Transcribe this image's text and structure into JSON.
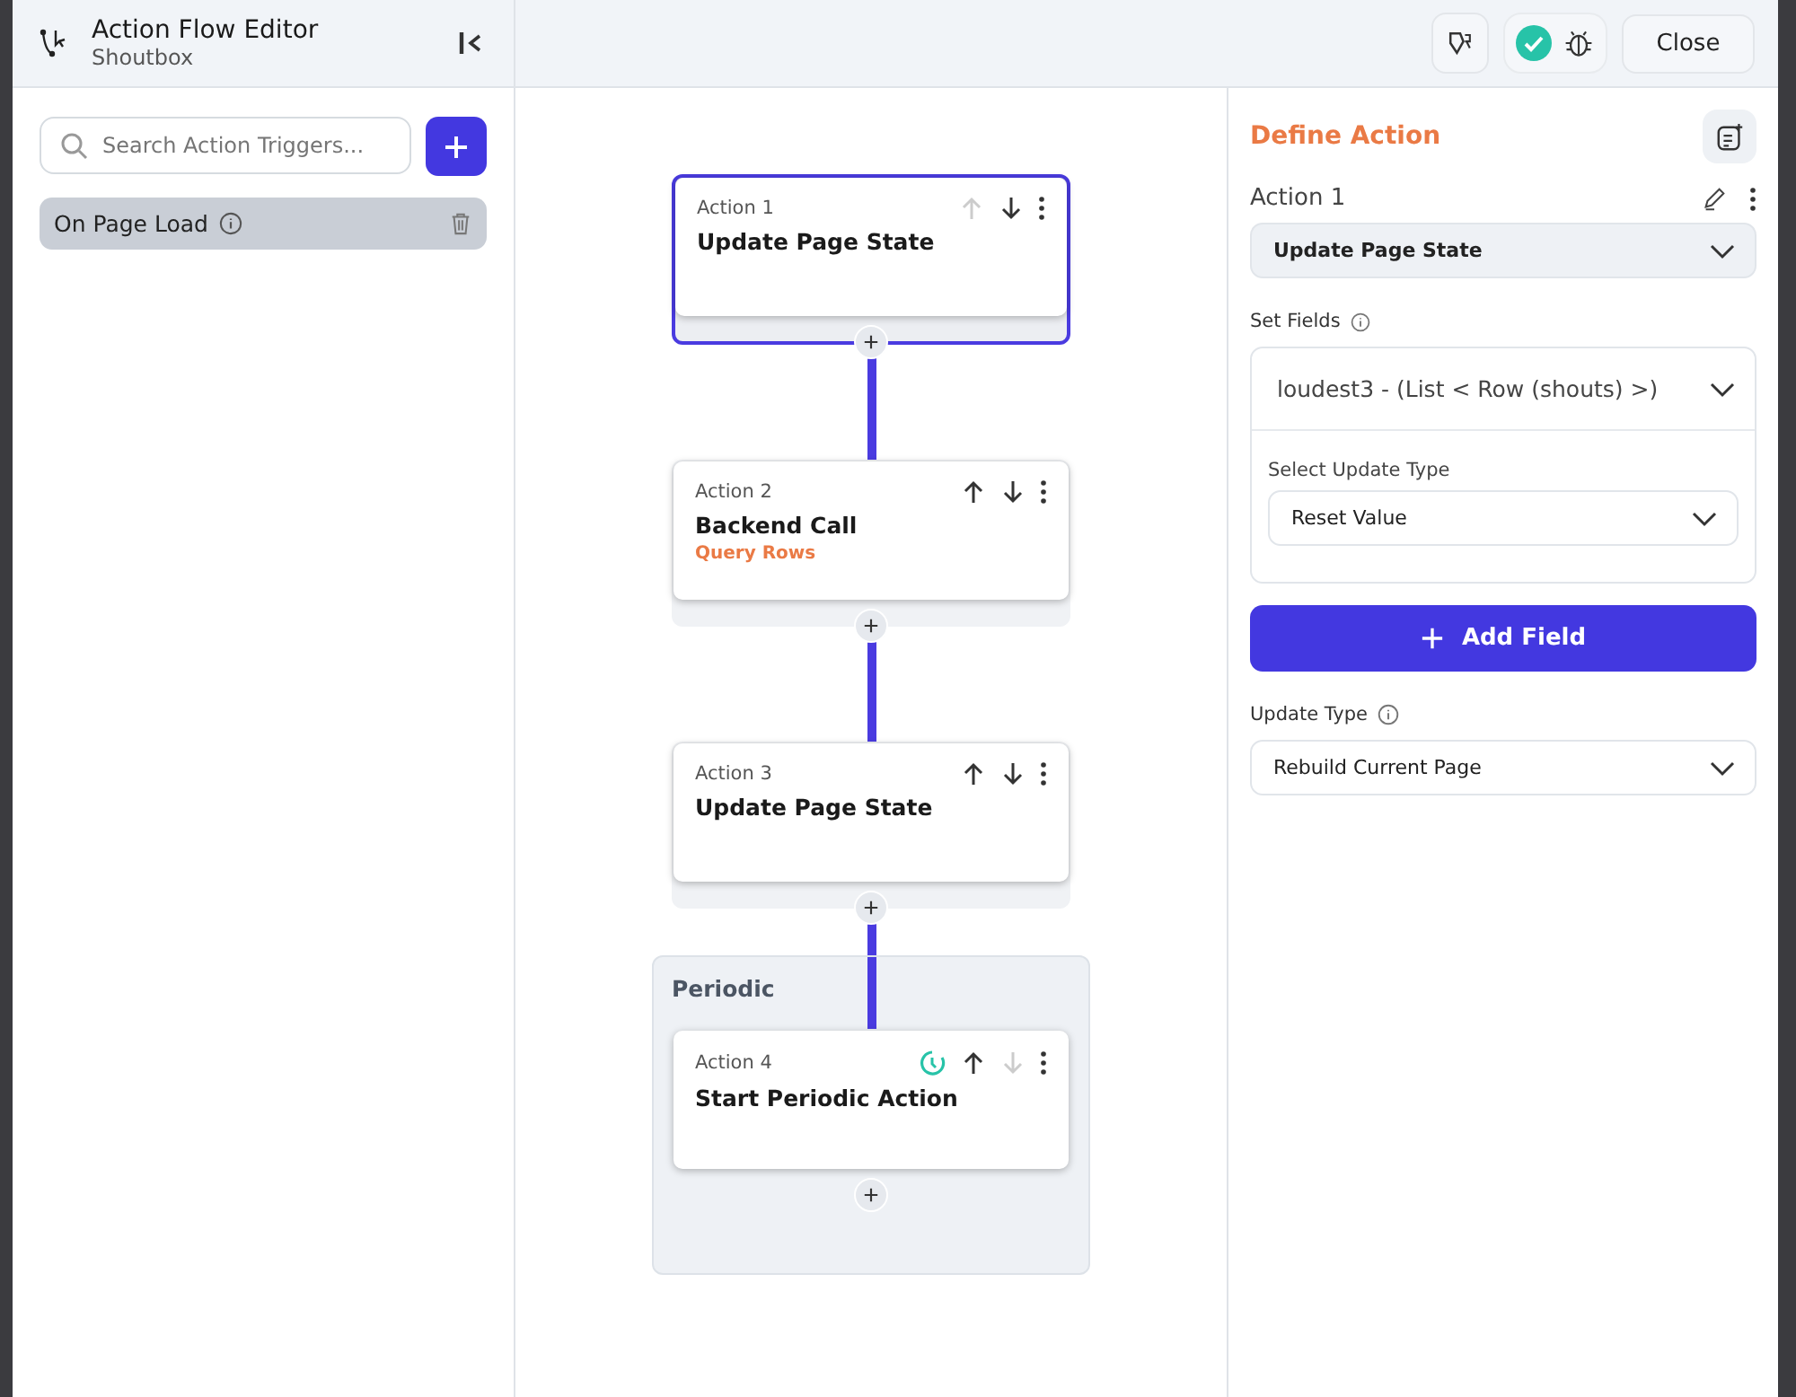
{
  "header": {
    "title": "Action Flow Editor",
    "subtitle": "Shoutbox",
    "close_button": "Close"
  },
  "triggers": {
    "search_placeholder": "Search Action Triggers...",
    "items": [
      {
        "label": "On Page Load",
        "selected": true
      }
    ]
  },
  "actions": [
    {
      "kind": "standard",
      "label": "Action 1",
      "title": "Update Page State",
      "selected": true,
      "can_move_up": false,
      "can_move_down": true
    },
    {
      "kind": "standard",
      "label": "Action 2",
      "title": "Backend Call",
      "subtitle": "Query Rows",
      "selected": false,
      "can_move_up": true,
      "can_move_down": true
    },
    {
      "kind": "standard",
      "label": "Action 3",
      "title": "Update Page State",
      "selected": false,
      "can_move_up": true,
      "can_move_down": true
    },
    {
      "kind": "periodic",
      "group_label": "Periodic",
      "label": "Action 4",
      "title": "Start Periodic Action",
      "selected": false,
      "can_move_up": true,
      "can_move_down": false
    }
  ],
  "define_action": {
    "heading": "Define Action",
    "action_name": "Action 1",
    "action_type": "Update Page State",
    "set_fields_label": "Set Fields",
    "field": "loudest3 - (List < Row (shouts) >)",
    "update_type_select_label": "Select Update Type",
    "update_type_select_value": "Reset Value",
    "add_field_button": "Add Field",
    "update_type_label": "Update Type",
    "update_type_value": "Rebuild Current Page"
  }
}
